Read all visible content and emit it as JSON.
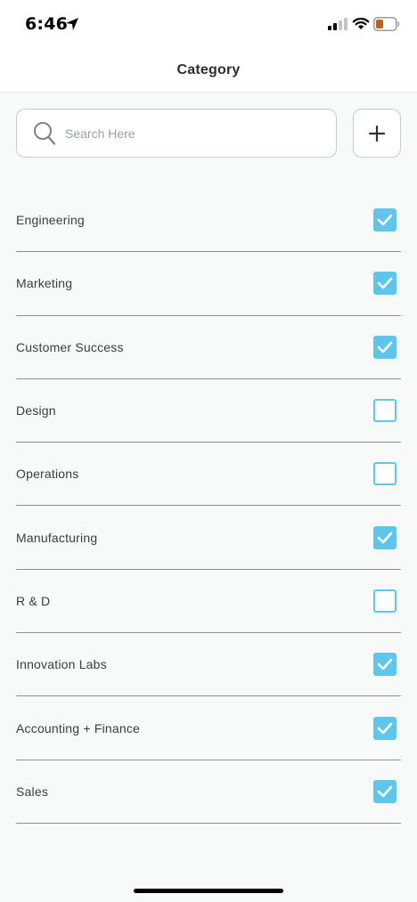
{
  "status_bar": {
    "time": "6:46",
    "icons": [
      "location-arrow-icon",
      "cellular-signal-icon",
      "wifi-icon",
      "battery-icon"
    ]
  },
  "nav": {
    "title": "Category"
  },
  "search": {
    "placeholder": "Search Here",
    "icon": "search-icon"
  },
  "add_button": {
    "icon": "plus-icon"
  },
  "categories": [
    {
      "label": "Engineering",
      "checked": true
    },
    {
      "label": "Marketing",
      "checked": true
    },
    {
      "label": "Customer Success",
      "checked": true
    },
    {
      "label": "Design",
      "checked": false
    },
    {
      "label": "Operations",
      "checked": false
    },
    {
      "label": "Manufacturing",
      "checked": true
    },
    {
      "label": "R & D",
      "checked": false
    },
    {
      "label": "Innovation Labs",
      "checked": true
    },
    {
      "label": "Accounting + Finance",
      "checked": true
    },
    {
      "label": "Sales",
      "checked": true
    }
  ],
  "colors": {
    "accent": "#5ec6ea",
    "background": "#f8f9f9",
    "divider": "#8e9194",
    "text": "#3a3d40",
    "battery_level": "#b5651d"
  }
}
